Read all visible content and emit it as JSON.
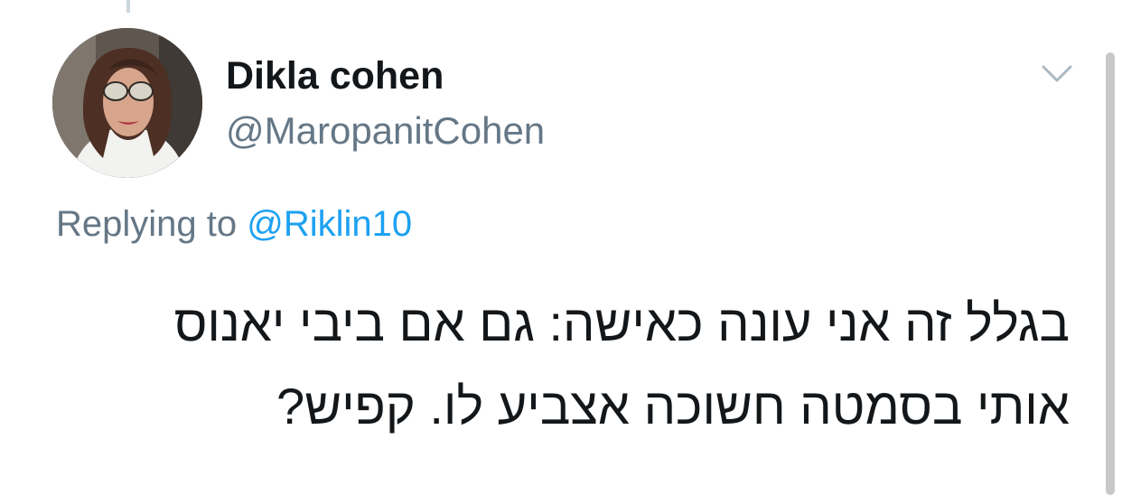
{
  "tweet": {
    "display_name": "Dikla cohen",
    "handle": "@MaropanitCohen",
    "reply_prefix": "Replying to",
    "reply_mention": "@Riklin10",
    "text_lines": [
      "בגלל זה אני עונה כאישה: גם אם ביבי יאנוס",
      "אותי בסמטה חשוכה אצביע לו. קפיש?"
    ]
  },
  "icons": {
    "avatar": "profile-photo",
    "menu": "chevron-down-icon"
  },
  "colors": {
    "name": "#14171a",
    "secondary": "#657786",
    "link": "#1da1f2",
    "background": "#ffffff"
  }
}
